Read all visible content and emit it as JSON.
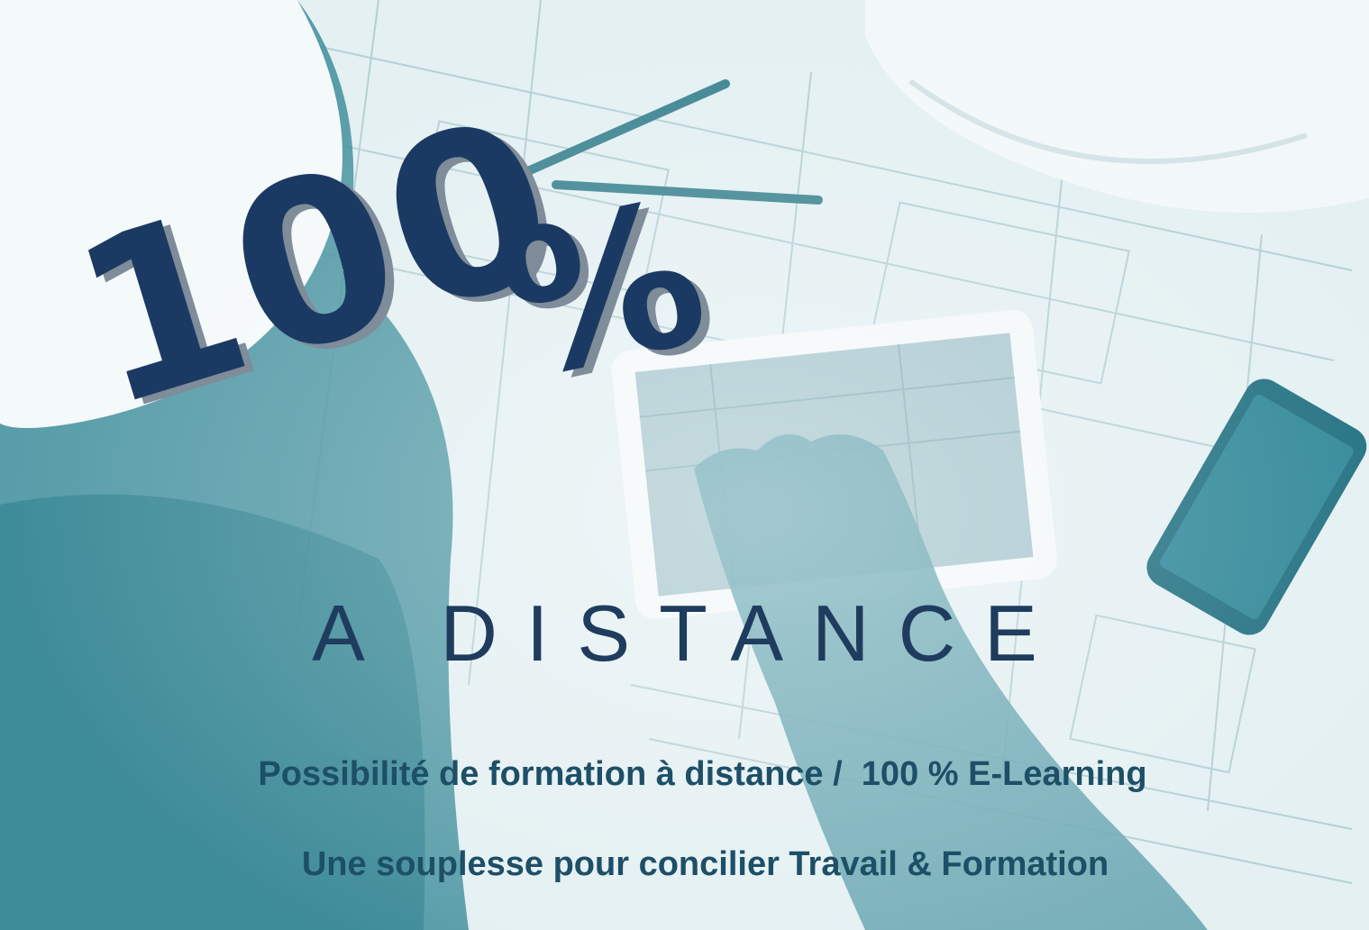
{
  "headline": {
    "number": "100",
    "percent": "%",
    "subtitle": "A DISTANCE"
  },
  "taglines": {
    "line1": "Possibilité de formation à distance /  100 % E-Learning",
    "line2": "Une souplesse pour concilier Travail & Formation"
  },
  "colors": {
    "headline": "#1b3a63",
    "headline_shadow": "#7f8c99",
    "subtitle": "#1f3c5e",
    "tagline": "#1d4f67",
    "photo_tint": "#2f8a99"
  }
}
